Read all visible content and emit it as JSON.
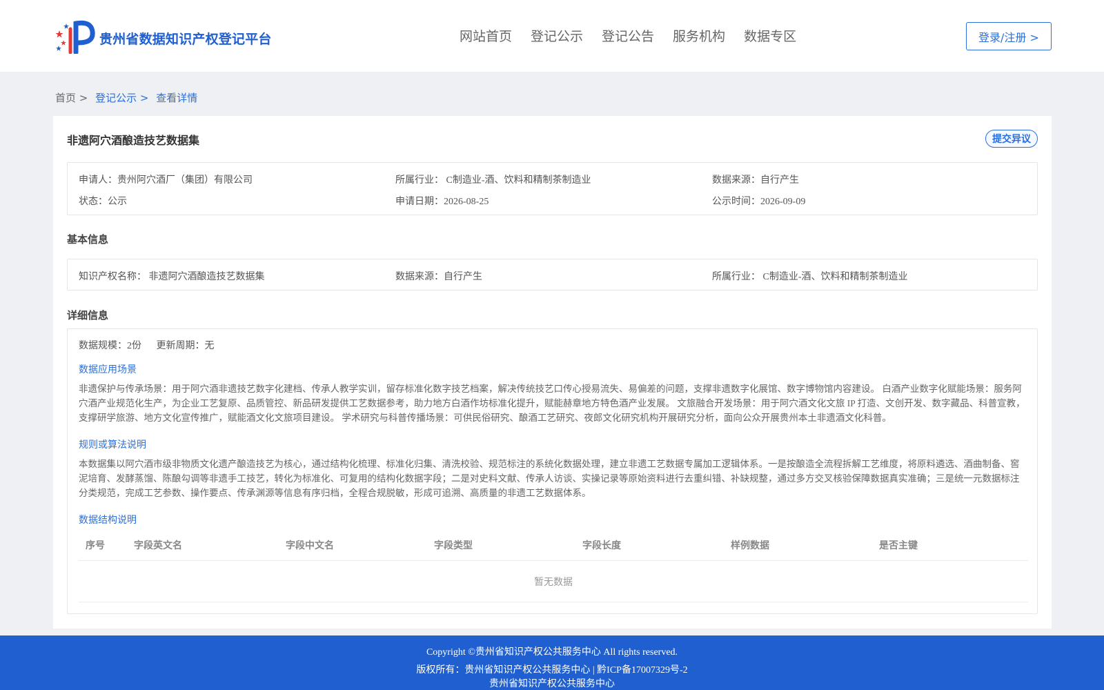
{
  "header": {
    "site_title": "贵州省数据知识产权登记平台",
    "nav": [
      "网站首页",
      "登记公示",
      "登记公告",
      "服务机构",
      "数据专区"
    ],
    "login_label": "登录/注册 >"
  },
  "breadcrumb": {
    "home": "首页 >",
    "list": "登记公示 >",
    "current": "查看详情"
  },
  "record": {
    "title": "非遗阿穴酒酿造技艺数据集",
    "objection_label": "提交异议",
    "summary": {
      "applicant": "申请人：贵州阿穴酒厂（集团）有限公司",
      "industry": "所属行业： C制造业-酒、饮料和精制茶制造业",
      "source": "数据来源：自行产生",
      "status": "状态：公示",
      "apply_date": "申请日期：2026-08-25",
      "publish_date": "公示时间：2026-09-09"
    }
  },
  "basic": {
    "title": "基本信息",
    "ip_name": "知识产权名称： 非遗阿穴酒酿造技艺数据集",
    "source": "数据来源：自行产生",
    "industry": "所属行业： C制造业-酒、饮料和精制茶制造业"
  },
  "detail": {
    "title": "详细信息",
    "scale": "数据规模：2份",
    "update_cycle": "更新周期：无",
    "scenario_heading": "数据应用场景",
    "scenario_text": "非遗保护与传承场景：用于阿穴酒非遗技艺数字化建档、传承人教学实训，留存标准化数字技艺档案，解决传统技艺口传心授易流失、易偏差的问题，支撑非遗数字化展馆、数字博物馆内容建设。 白酒产业数字化赋能场景：服务阿穴酒产业规范化生产，为企业工艺复原、品质管控、新品研发提供工艺数据参考，助力地方白酒作坊标准化提升，赋能赫章地方特色酒产业发展。 文旅融合开发场景：用于阿穴酒文化文旅 IP 打造、文创开发、数字藏品、科普宣教，支撑研学旅游、地方文化宣传推广，赋能酒文化文旅项目建设。 学术研究与科普传播场景：可供民俗研究、酿酒工艺研究、夜郎文化研究机构开展研究分析，面向公众开展贵州本土非遗酒文化科普。",
    "rule_heading": "规则或算法说明",
    "rule_text": "本数据集以阿穴酒市级非物质文化遗产酿造技艺为核心，通过结构化梳理、标准化归集、清洗校验、规范标注的系统化数据处理，建立非遗工艺数据专属加工逻辑体系。一是按酿造全流程拆解工艺维度，将原料遴选、酒曲制备、窖泥培育、发酵蒸馏、陈酿勾调等非遗手工技艺，转化为标准化、可复用的结构化数据字段；二是对史料文献、传承人访谈、实操记录等原始资料进行去重纠错、补缺规整，通过多方交叉核验保障数据真实准确；三是统一元数据标注分类规范，完成工艺参数、操作要点、传承渊源等信息有序归档，全程合规脱敏，形成可追溯、高质量的非遗工艺数据体系。",
    "structure_heading": "数据结构说明",
    "table_headers": [
      "序号",
      "字段英文名",
      "字段中文名",
      "字段类型",
      "字段长度",
      "样例数据",
      "是否主键"
    ],
    "empty_text": "暂无数据"
  },
  "footer": {
    "copyright": "Copyright ©贵州省知识产权公共服务中心 All rights reserved.",
    "rights": "版权所有：贵州省知识产权公共服务中心 | 黔ICP备17007329号-2",
    "org": "贵州省知识产权公共服务中心"
  },
  "colors": {
    "brand": "#1f5fcf",
    "accent": "#2a6fdb",
    "logo_red": "#e53935"
  }
}
